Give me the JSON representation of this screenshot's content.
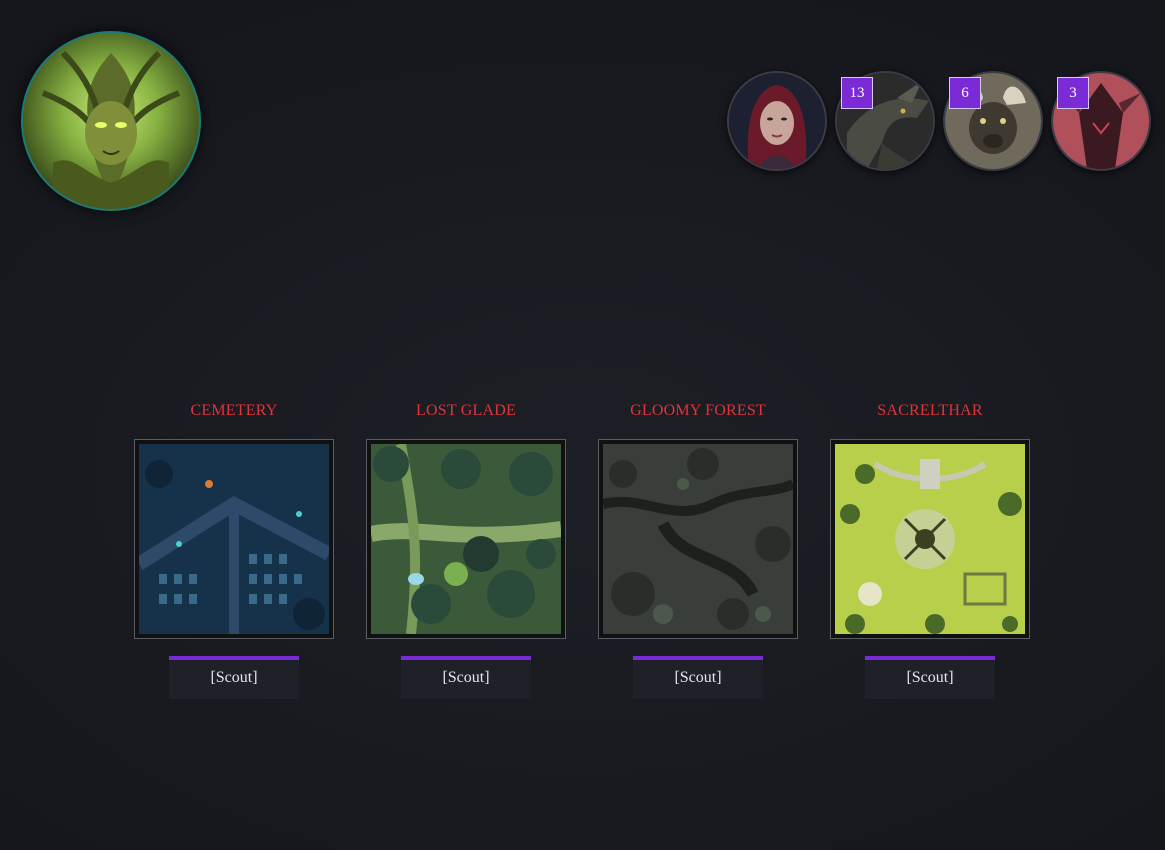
{
  "player": {
    "avatar_icon": "dryad-portrait"
  },
  "enemies": [
    {
      "icon": "red-haired-woman-portrait",
      "count": ""
    },
    {
      "icon": "dragon-portrait",
      "count": "13"
    },
    {
      "icon": "minotaur-portrait",
      "count": "6"
    },
    {
      "icon": "crimson-demon-portrait",
      "count": "3"
    }
  ],
  "locations": [
    {
      "title": "CEMETERY",
      "map_icon": "cemetery-map",
      "action": "[Scout]"
    },
    {
      "title": "LOST GLADE",
      "map_icon": "lost-glade-map",
      "action": "[Scout]"
    },
    {
      "title": "GLOOMY FOREST",
      "map_icon": "gloomy-forest-map",
      "action": "[Scout]"
    },
    {
      "title": "SACRELTHAR",
      "map_icon": "sacrelthar-map",
      "action": "[Scout]"
    }
  ],
  "colors": {
    "accent": "#7b2bd6",
    "title": "#e0333c",
    "background": "#1a1b21"
  }
}
